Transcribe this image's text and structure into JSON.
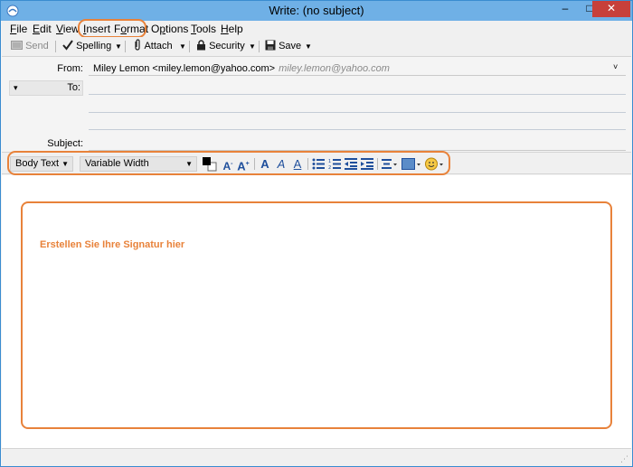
{
  "window": {
    "title": "Write: (no subject)",
    "minimize_glyph": "–",
    "maximize_glyph": "□",
    "close_glyph": "✕"
  },
  "menu": [
    {
      "pre": "",
      "acc": "F",
      "post": "ile"
    },
    {
      "pre": "",
      "acc": "E",
      "post": "dit"
    },
    {
      "pre": "",
      "acc": "V",
      "post": "iew"
    },
    {
      "pre": "",
      "acc": "I",
      "post": "nsert"
    },
    {
      "pre": "F",
      "acc": "o",
      "post": "rmat"
    },
    {
      "pre": "O",
      "acc": "p",
      "post": "tions"
    },
    {
      "pre": "",
      "acc": "T",
      "post": "ools"
    },
    {
      "pre": "",
      "acc": "H",
      "post": "elp"
    }
  ],
  "toolbar": {
    "send": "Send",
    "spelling": "Spelling",
    "attach": "Attach",
    "security": "Security",
    "save": "Save"
  },
  "header": {
    "from_label": "From:",
    "from_value": "Miley Lemon <miley.lemon@yahoo.com>",
    "from_alt": "miley.lemon@yahoo.com",
    "to_type": "To:",
    "subject_label": "Subject:"
  },
  "format": {
    "paragraph": "Body Text",
    "font": "Variable Width"
  },
  "body": {
    "signature_placeholder": "Erstellen Sie Ihre Signatur hier"
  },
  "colors": {
    "highlight": "#e8823a",
    "titlebar": "#6fb0e6",
    "close": "#c7403a"
  }
}
